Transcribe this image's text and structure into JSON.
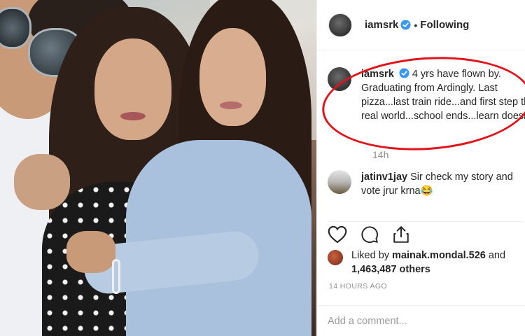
{
  "header": {
    "username": "iamsrk",
    "separator": "•",
    "follow_status": "Following"
  },
  "caption": {
    "username": "iamsrk",
    "text": "4 yrs have flown by. Graduating from Ardingly. Last pizza...last train ride...and first step the real world...school ends...learn doesn't.",
    "time": "14h"
  },
  "comments": [
    {
      "username": "jatinv1jay",
      "text": "Sir check my story and vote jrur krna😂"
    }
  ],
  "actions": {
    "like_icon": "heart-icon",
    "comment_icon": "comment-icon",
    "share_icon": "share-icon"
  },
  "likes": {
    "prefix": "Liked by",
    "user": "mainak.mondal.526",
    "and": "and",
    "count": "1,463,487 others"
  },
  "timestamp": "14 HOURS AGO",
  "add_comment": {
    "placeholder": "Add a comment..."
  },
  "colors": {
    "verified": "#3897f0",
    "highlight": "#e2141b",
    "muted": "#8e8e8e"
  }
}
